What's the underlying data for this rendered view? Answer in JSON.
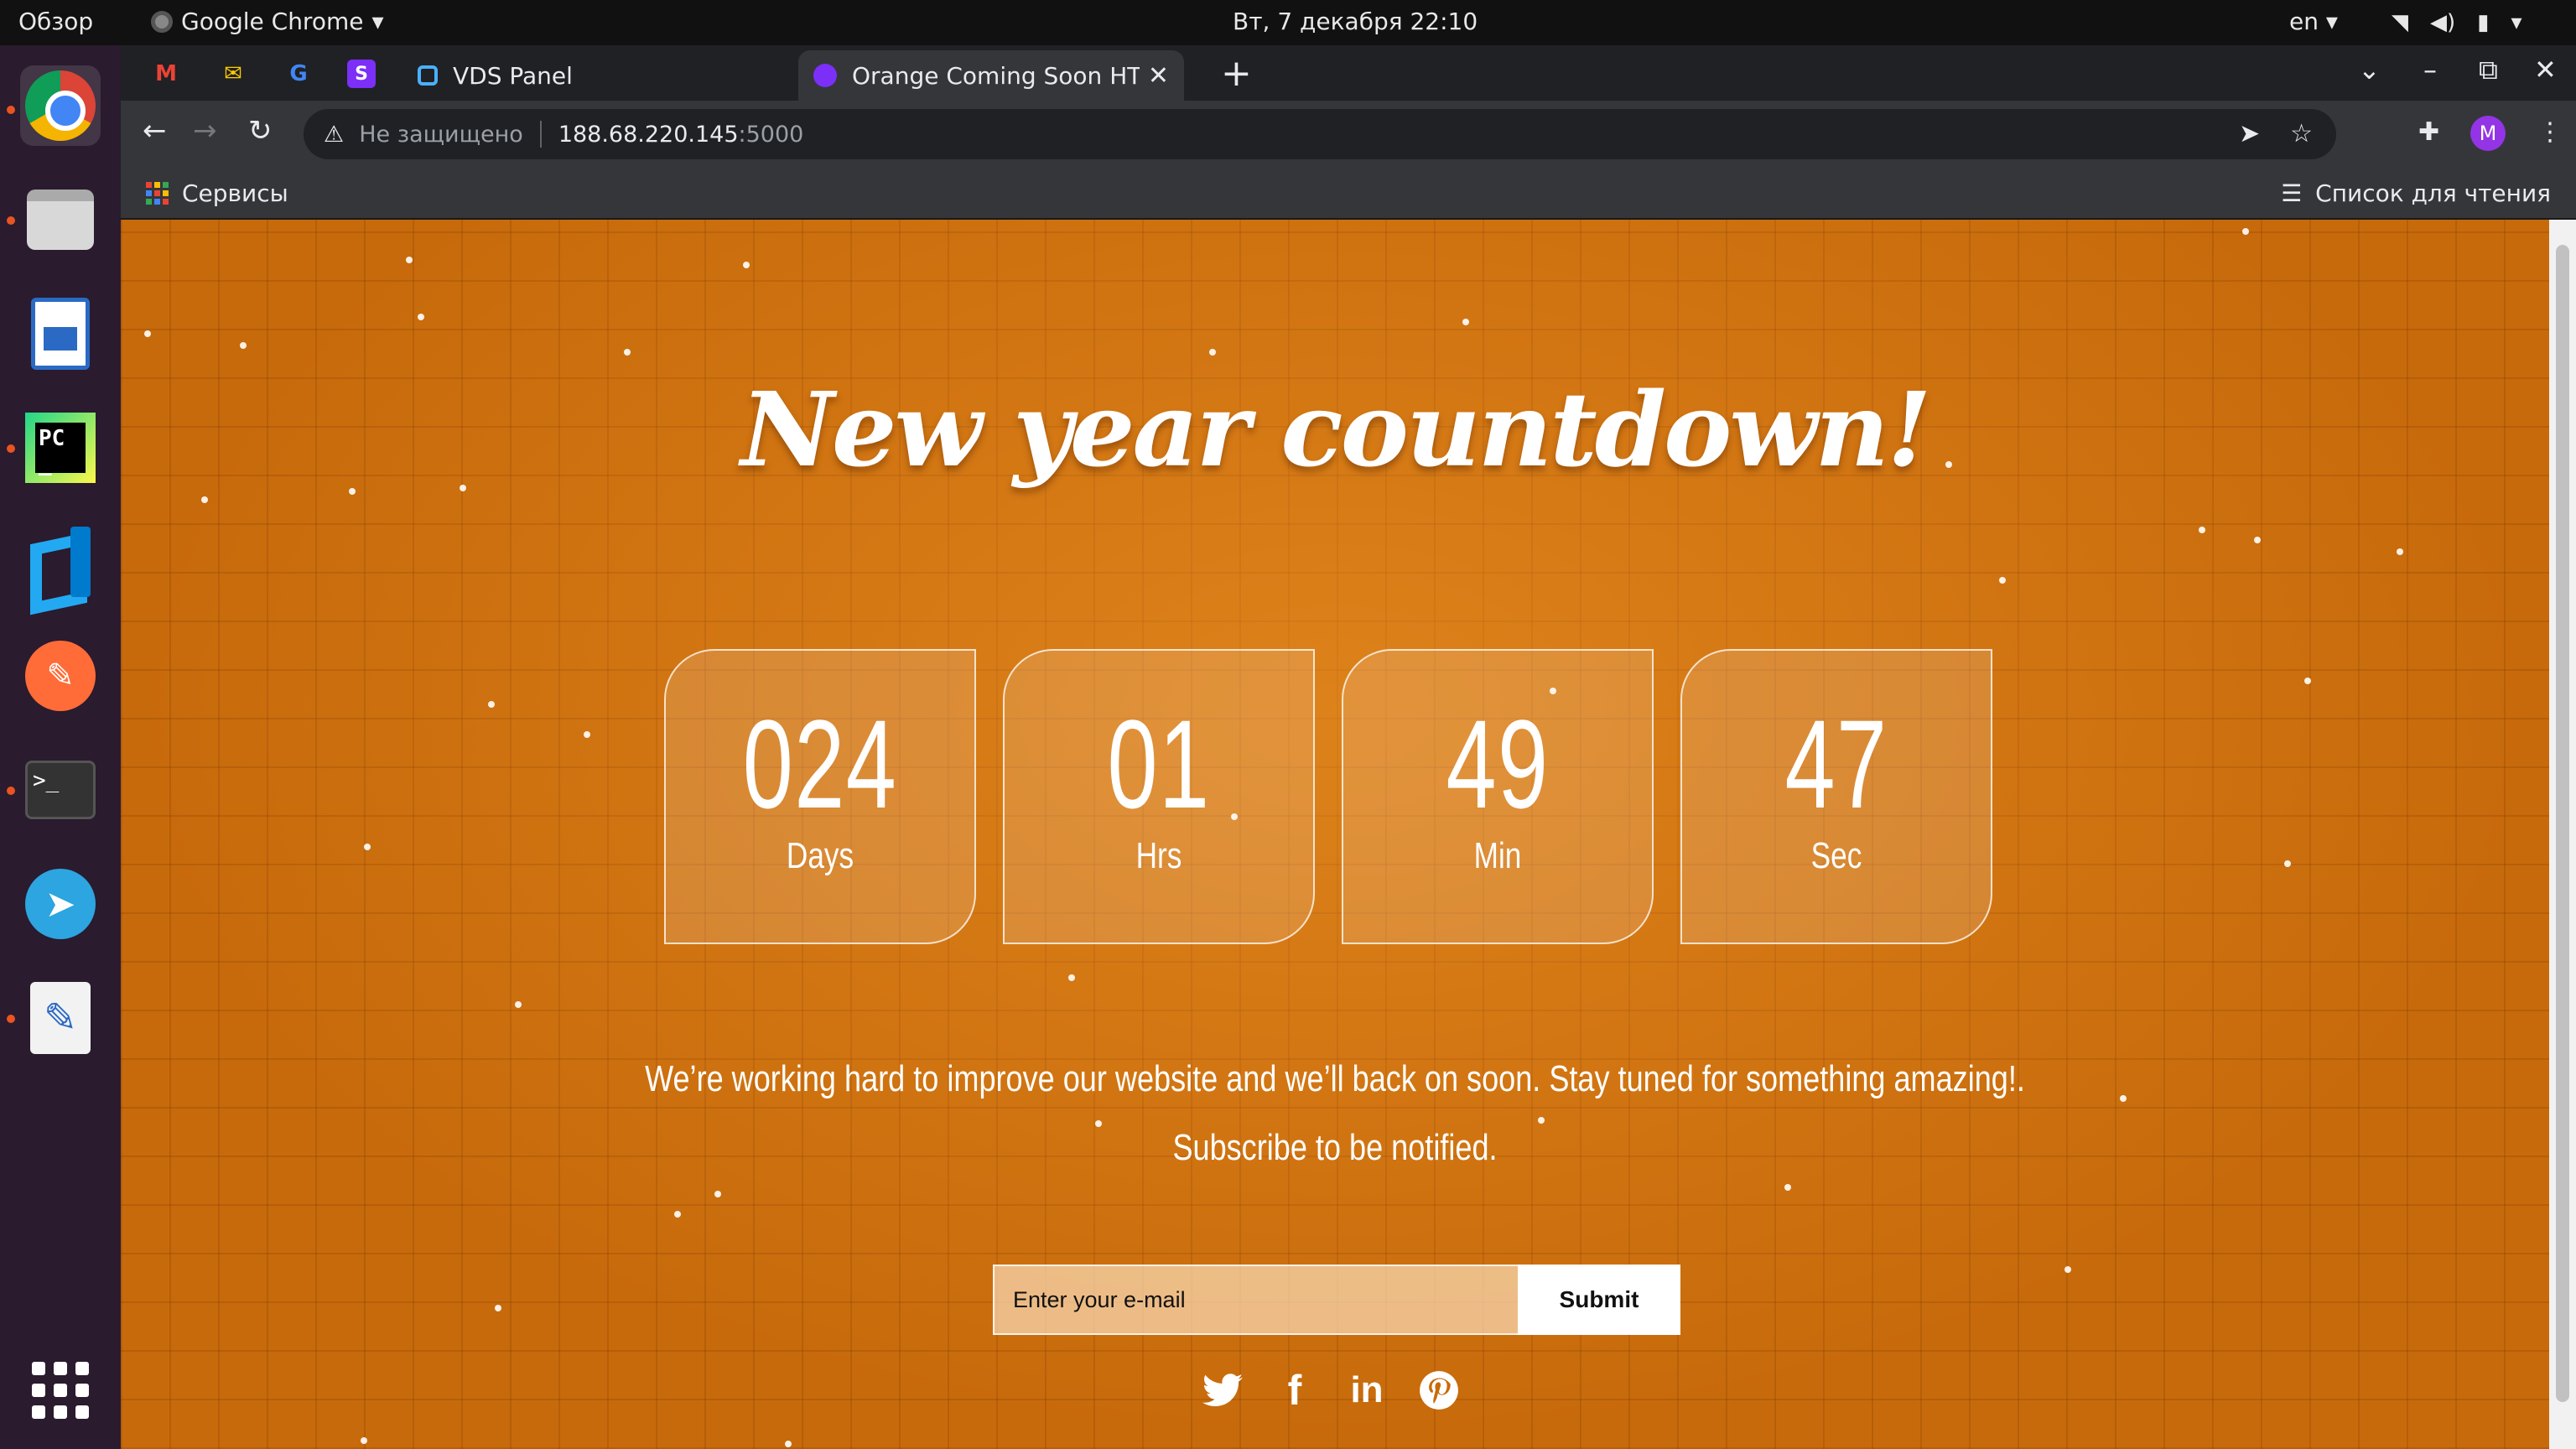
{
  "topbar": {
    "overview": "Обзор",
    "app_name": "Google Chrome",
    "clock": "Вт, 7 декабря  22:10",
    "language": "en"
  },
  "dock": {
    "items": [
      {
        "name": "chrome",
        "running": true
      },
      {
        "name": "files",
        "running": true
      },
      {
        "name": "libreoffice-writer",
        "running": false
      },
      {
        "name": "pycharm",
        "running": true
      },
      {
        "name": "vscode",
        "running": false
      },
      {
        "name": "postman",
        "running": false
      },
      {
        "name": "terminal",
        "running": true
      },
      {
        "name": "telegram",
        "running": false
      },
      {
        "name": "text-editor",
        "running": true
      }
    ]
  },
  "browser": {
    "tabs": [
      {
        "title": "VDS Panel",
        "active": false
      },
      {
        "title": "Orange Coming Soon HTML",
        "active": true
      }
    ],
    "address": {
      "security": "Не защищено",
      "host": "188.68.220.145",
      "port": ":5000"
    },
    "profile_initial": "M",
    "bookmarks": {
      "apps_label": "Сервисы",
      "reading_list_label": "Список для чтения"
    }
  },
  "page": {
    "title": "New year countdown!",
    "countdown": [
      {
        "value": "024",
        "label": "Days"
      },
      {
        "value": "01",
        "label": "Hrs"
      },
      {
        "value": "49",
        "label": "Min"
      },
      {
        "value": "47",
        "label": "Sec"
      }
    ],
    "message": "We’re working hard to improve our website and we’ll back on soon. Stay tuned for something amazing!.",
    "subscribe_text": "Subscribe to be notified.",
    "email_placeholder": "Enter your e-mail",
    "submit_label": "Submit",
    "social": [
      "twitter",
      "facebook",
      "linkedin",
      "pinterest"
    ]
  },
  "colors": {
    "page_background": "#c76a0b",
    "accent_white": "#ffffff",
    "chrome_dark": "#202124",
    "chrome_toolbar": "#35363a",
    "dock_background": "#2a1b2e"
  }
}
